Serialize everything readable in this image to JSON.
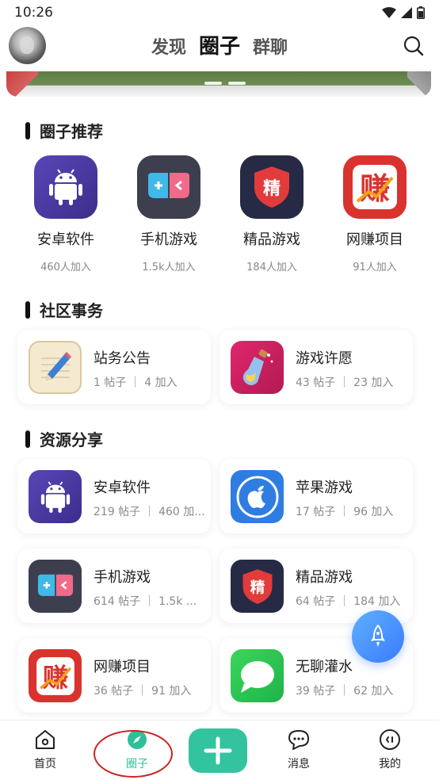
{
  "status": {
    "time": "10:26"
  },
  "nav": {
    "tabs": [
      "发现",
      "圈子",
      "群聊"
    ],
    "active_tab": 1
  },
  "sections": {
    "recommend": "圈子推荐",
    "community": "社区事务",
    "resources": "资源分享"
  },
  "recommended": [
    {
      "name": "安卓软件",
      "joined": "460人加入",
      "icon": "android-icon",
      "bg": "#4b3a9c"
    },
    {
      "name": "手机游戏",
      "joined": "1.5k人加入",
      "icon": "gamepad-icon",
      "bg": "#3d3f4e"
    },
    {
      "name": "精品游戏",
      "joined": "184人加入",
      "icon": "shield-jing-icon",
      "bg": "#262a44"
    },
    {
      "name": "网赚项目",
      "joined": "91人加入",
      "icon": "zhuan-icon",
      "bg": "#d9332f"
    }
  ],
  "community": [
    {
      "title": "站务公告",
      "meta": "1 帖子 ｜ 4 加入",
      "icon": "notepad-icon"
    },
    {
      "title": "游戏许愿",
      "meta": "43 帖子 ｜ 23 加入",
      "icon": "wish-bottle-icon"
    }
  ],
  "resources": [
    {
      "title": "安卓软件",
      "meta": "219 帖子 ｜ 460 加...",
      "icon": "android-icon"
    },
    {
      "title": "苹果游戏",
      "meta": "17 帖子 ｜ 96 加入",
      "icon": "apple-icon"
    },
    {
      "title": "手机游戏",
      "meta": "614 帖子 ｜ 1.5k ...",
      "icon": "gamepad-icon"
    },
    {
      "title": "精品游戏",
      "meta": "64 帖子 ｜ 184 加入",
      "icon": "shield-jing-icon"
    },
    {
      "title": "网赚项目",
      "meta": "36 帖子 ｜ 91 加入",
      "icon": "zhuan-icon"
    },
    {
      "title": "无聊灌水",
      "meta": "39 帖子 ｜ 62 加入",
      "icon": "chat-bubble-icon"
    }
  ],
  "bottom_nav": [
    {
      "label": "首页",
      "icon": "home-icon"
    },
    {
      "label": "圈子",
      "icon": "compass-icon",
      "active": true
    },
    {
      "label": "消息",
      "icon": "message-icon"
    },
    {
      "label": "我的",
      "icon": "profile-icon"
    }
  ],
  "colors": {
    "accent": "#33c49f",
    "active_label": "#2fbf9a",
    "fab": "#3a7bff",
    "annotation_ring": "#c82424"
  }
}
